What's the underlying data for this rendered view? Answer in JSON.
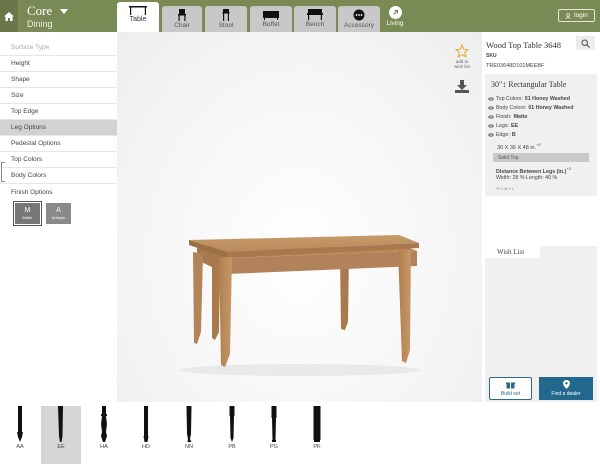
{
  "header": {
    "brand_title": "Core",
    "brand_subtitle": "Dining",
    "tabs": [
      {
        "label": "Table",
        "icon": "table-icon"
      },
      {
        "label": "Chair",
        "icon": "chair-icon"
      },
      {
        "label": "Stool",
        "icon": "stool-icon"
      },
      {
        "label": "Buffet",
        "icon": "buffet-icon"
      },
      {
        "label": "Bench",
        "icon": "bench-icon"
      },
      {
        "label": "Accessory",
        "icon": "accessory-icon"
      }
    ],
    "living_label": "Living",
    "login_label": "login"
  },
  "sidebar": {
    "items": [
      {
        "label": "Surface Type"
      },
      {
        "label": "Height"
      },
      {
        "label": "Shape"
      },
      {
        "label": "Size"
      },
      {
        "label": "Top Edge"
      },
      {
        "label": "Leg Options"
      },
      {
        "label": "Pedestal Options"
      },
      {
        "label": "Top Colors"
      },
      {
        "label": "Body Colors"
      },
      {
        "label": "Finish Options"
      }
    ],
    "finishes": [
      {
        "letter": "M",
        "name": "Matte"
      },
      {
        "letter": "A",
        "name": "Antique"
      }
    ]
  },
  "stage": {
    "add_to_wishlist": "add to wish list"
  },
  "product": {
    "title": "Wood Top Table 3648",
    "sku_label": "SKU",
    "sku": "TRE03648D101MEEBF"
  },
  "spec": {
    "heading": "30\"↕ Rectangular Table",
    "rows": [
      {
        "label": "Top Colors:",
        "value": "01 Honey Washed"
      },
      {
        "label": "Body Colors:",
        "value": "01 Honey Washed"
      },
      {
        "label": "Finish:",
        "value": "Matte"
      },
      {
        "label": "Legs:",
        "value": "EE"
      },
      {
        "label": "Edge:",
        "value": "B"
      }
    ],
    "dimensions": "30 X 36 X 48 in.",
    "dimensions_sup": "+2",
    "top_type": "Solid Top",
    "distance_label": "Distance Between Legs (in.)",
    "distance_sup": "+2",
    "width_length": "Width: 28 % Length: 40 %",
    "footnote": "*H X W X L"
  },
  "wishlist": {
    "tab_label": "Wish List",
    "build_label": "Build set",
    "find_label": "Find a dealer"
  },
  "legs": {
    "items": [
      {
        "code": "AA"
      },
      {
        "code": "EE"
      },
      {
        "code": "HA"
      },
      {
        "code": "HD"
      },
      {
        "code": "NN"
      },
      {
        "code": "PB"
      },
      {
        "code": "PG"
      },
      {
        "code": "PK"
      }
    ],
    "selected": "EE"
  },
  "colors": {
    "topbar": "#7a8a55",
    "accent_blue": "#22688e",
    "wood": "#b8875a"
  }
}
